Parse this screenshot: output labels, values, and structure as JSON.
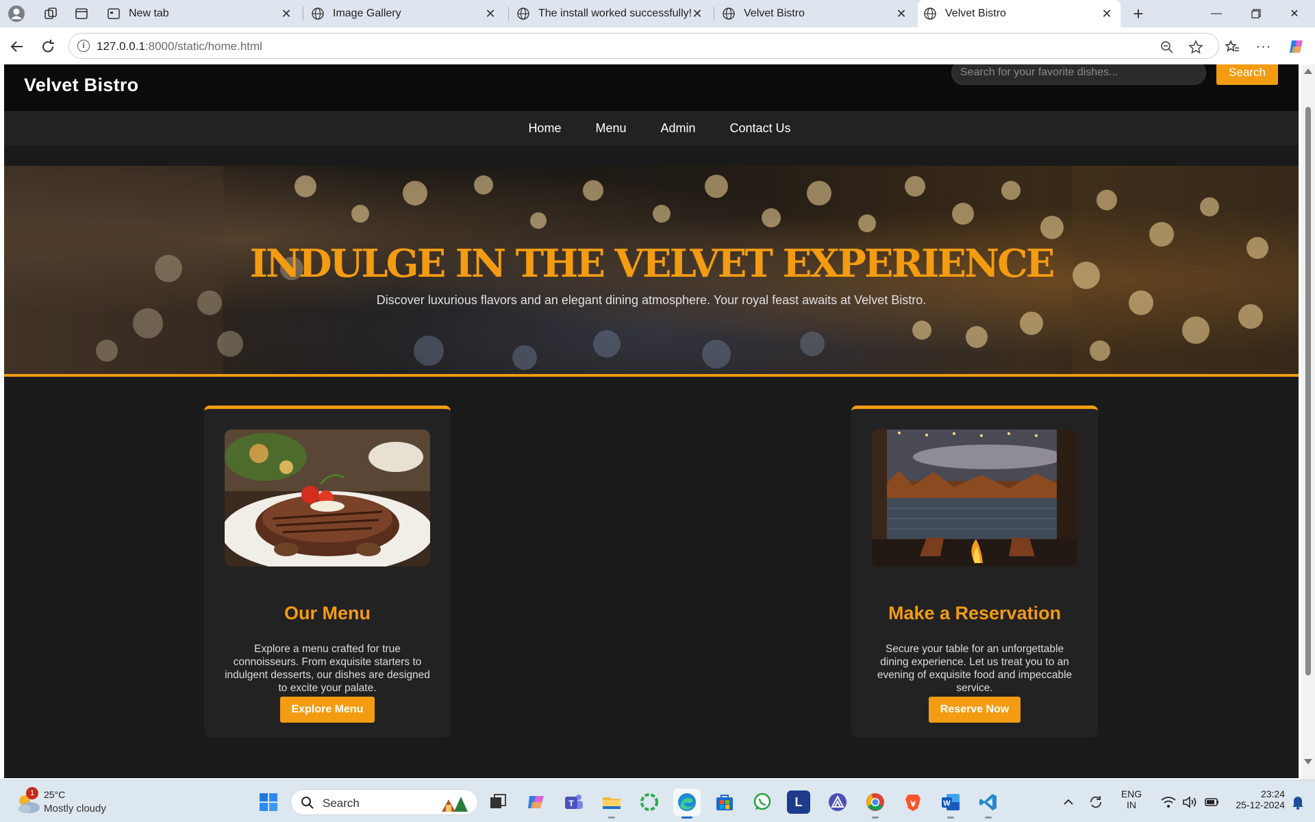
{
  "browser": {
    "tabs": [
      {
        "title": "New tab"
      },
      {
        "title": "Image Gallery"
      },
      {
        "title": "The install worked successfully! Co"
      },
      {
        "title": "Velvet Bistro"
      },
      {
        "title": "Velvet Bistro"
      }
    ],
    "url_host": "127.0.0.1",
    "url_path": ":8000/static/home.html"
  },
  "site": {
    "brand": "Velvet Bistro",
    "search_placeholder": "Search for your favorite dishes...",
    "search_button": "Search",
    "nav": [
      "Home",
      "Menu",
      "Admin",
      "Contact Us"
    ],
    "hero_title": "INDULGE IN THE VELVET EXPERIENCE",
    "hero_subtitle": "Discover luxurious flavors and an elegant dining atmosphere. Your royal feast awaits at Velvet Bistro.",
    "cards": [
      {
        "title": "Our Menu",
        "text": "Explore a menu crafted for true connoisseurs. From exquisite starters to indulgent desserts, our dishes are designed to excite your palate.",
        "button": "Explore Menu"
      },
      {
        "title": "Make a Reservation",
        "text": "Secure your table for an unforgettable dining experience. Let us treat you to an evening of exquisite food and impeccable service.",
        "button": "Reserve Now"
      }
    ],
    "accent_color": "#f39c12"
  },
  "taskbar": {
    "weather_temp": "25°C",
    "weather_condition": "Mostly cloudy",
    "weather_badge": "1",
    "search_label": "Search",
    "lang_top": "ENG",
    "lang_bottom": "IN",
    "time": "23:24",
    "date": "25-12-2024"
  }
}
